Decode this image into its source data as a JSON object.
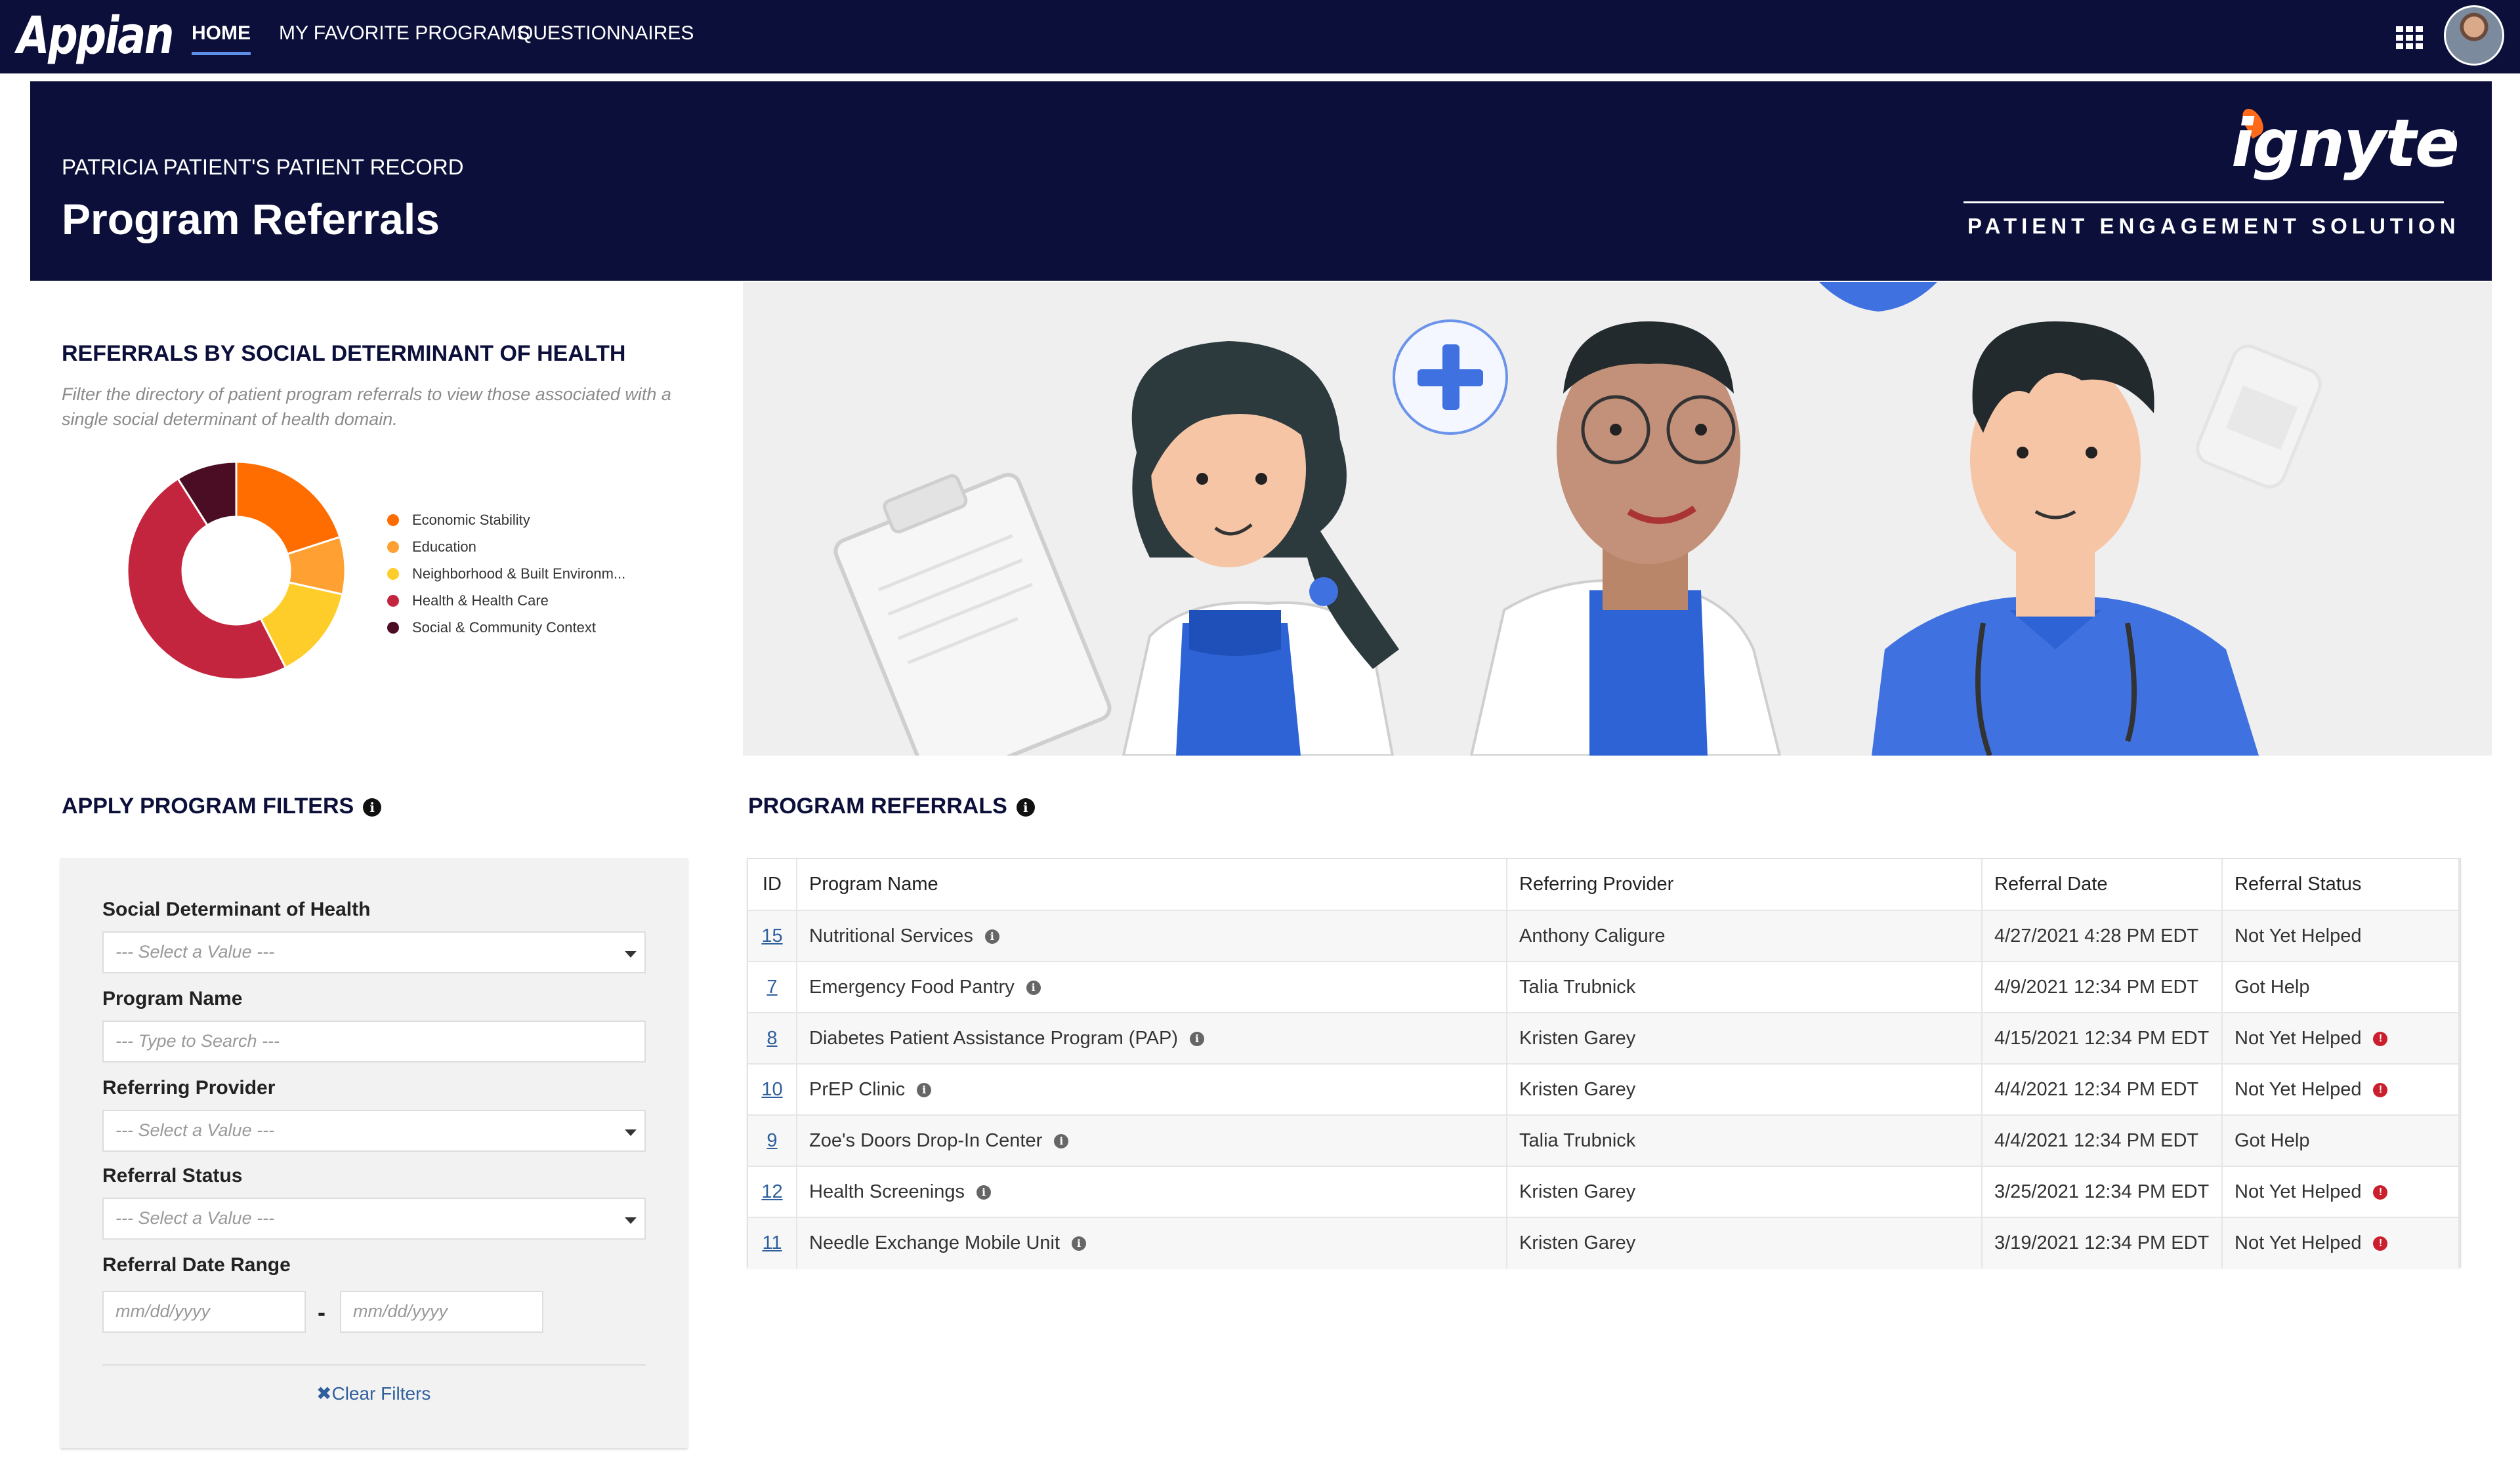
{
  "app": {
    "logo": "Appian",
    "nav": [
      "HOME",
      "MY FAVORITE PROGRAMS",
      "QUESTIONNAIRES"
    ],
    "active_tab": "HOME"
  },
  "header": {
    "subtitle": "PATRICIA PATIENT'S PATIENT RECORD",
    "title": "Program Referrals",
    "brand": "ignyte",
    "brand_tm": "™",
    "brand_tagline": "PATIENT ENGAGEMENT SOLUTION"
  },
  "donut_section": {
    "title": "REFERRALS BY SOCIAL DETERMINANT OF HEALTH",
    "description": "Filter the directory of patient program referrals to view those associated with a single social determinant of health domain."
  },
  "chart_data": {
    "type": "pie",
    "categories": [
      "Economic Stability",
      "Education",
      "Neighborhood & Built Environm...",
      "Health & Health Care",
      "Social & Community Context"
    ],
    "values": [
      20,
      8.5,
      14,
      48.5,
      9
    ],
    "colors": [
      "#ff6d00",
      "#ffa033",
      "#ffcd2a",
      "#c4253e",
      "#4a0d24"
    ],
    "donut": true,
    "legend": "right"
  },
  "filters": {
    "title": "APPLY PROGRAM FILTERS",
    "sdoh_label": "Social Determinant of Health",
    "sdoh_placeholder": "--- Select a Value ---",
    "program_label": "Program Name",
    "program_placeholder": "--- Type to Search ---",
    "provider_label": "Referring Provider",
    "provider_placeholder": "--- Select a Value ---",
    "status_label": "Referral Status",
    "status_placeholder": "--- Select a Value ---",
    "date_label": "Referral Date Range",
    "date_from_placeholder": "mm/dd/yyyy",
    "date_sep": "-",
    "date_to_placeholder": "mm/dd/yyyy",
    "clear_label": "Clear Filters"
  },
  "referrals": {
    "title": "PROGRAM REFERRALS",
    "columns": [
      "ID",
      "Program Name",
      "Referring Provider",
      "Referral Date",
      "Referral Status"
    ],
    "rows": [
      {
        "id": "15",
        "program": "Nutritional Services",
        "provider": "Anthony Caligure",
        "date": "4/27/2021 4:28 PM EDT",
        "status": "Not Yet Helped",
        "alert": false
      },
      {
        "id": "7",
        "program": "Emergency Food Pantry",
        "provider": "Talia Trubnick",
        "date": "4/9/2021 12:34 PM EDT",
        "status": "Got Help",
        "alert": false
      },
      {
        "id": "8",
        "program": "Diabetes Patient Assistance Program (PAP)",
        "provider": "Kristen Garey",
        "date": "4/15/2021 12:34 PM EDT",
        "status": "Not Yet Helped",
        "alert": true
      },
      {
        "id": "10",
        "program": "PrEP Clinic",
        "provider": "Kristen Garey",
        "date": "4/4/2021 12:34 PM EDT",
        "status": "Not Yet Helped",
        "alert": true
      },
      {
        "id": "9",
        "program": "Zoe's Doors Drop-In Center",
        "provider": "Talia Trubnick",
        "date": "4/4/2021 12:34 PM EDT",
        "status": "Got Help",
        "alert": false
      },
      {
        "id": "12",
        "program": "Health Screenings",
        "provider": "Kristen Garey",
        "date": "3/25/2021 12:34 PM EDT",
        "status": "Not Yet Helped",
        "alert": true
      },
      {
        "id": "11",
        "program": "Needle Exchange Mobile Unit",
        "provider": "Kristen Garey",
        "date": "3/19/2021 12:34 PM EDT",
        "status": "Not Yet Helped",
        "alert": true
      }
    ]
  }
}
